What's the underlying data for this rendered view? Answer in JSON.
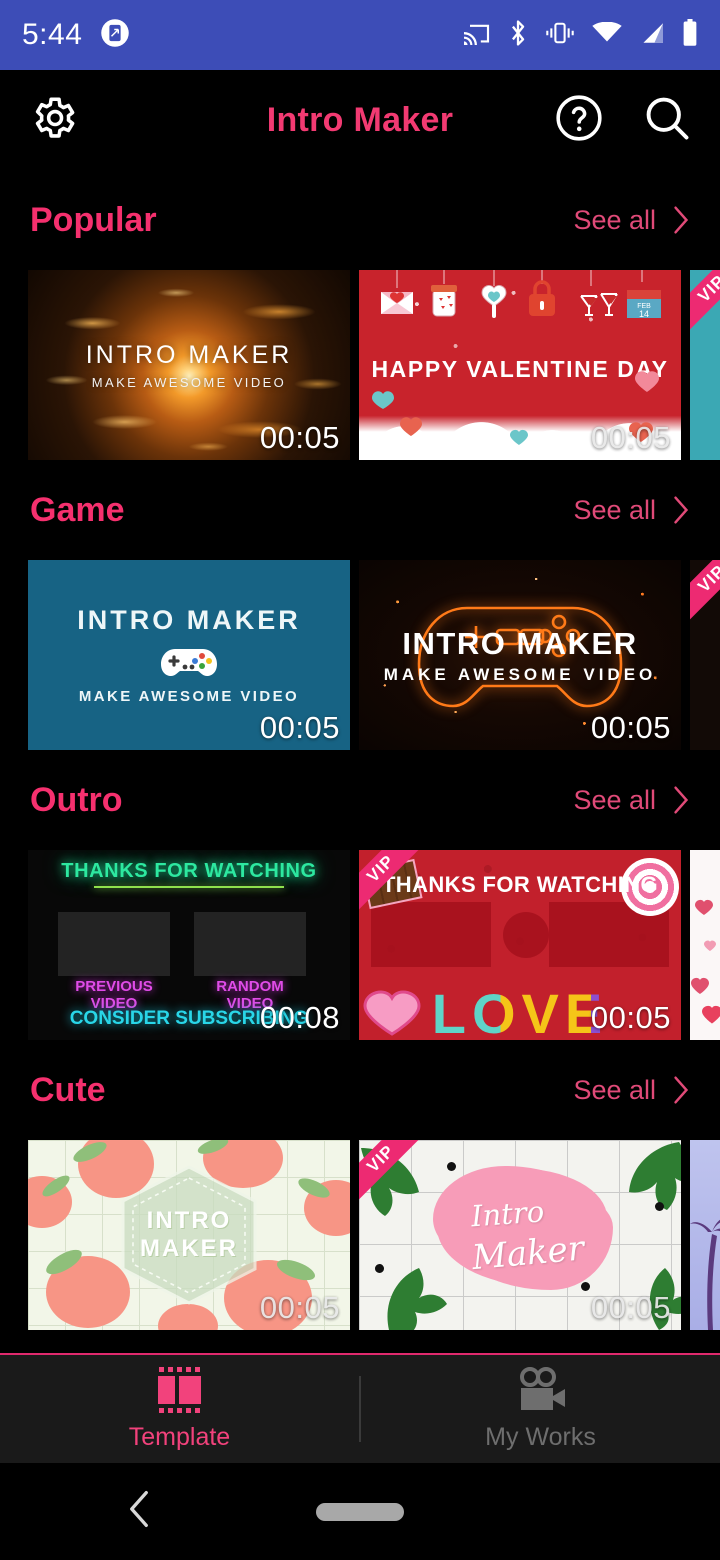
{
  "status_bar": {
    "time": "5:44",
    "bg_color": "#3D4DB7",
    "icons": [
      "screenshot-icon",
      "cast-icon",
      "bluetooth-icon",
      "vibrate-icon",
      "wifi-icon",
      "cellular-signal-icon",
      "battery-icon"
    ]
  },
  "app_bar": {
    "title": "Intro Maker",
    "title_color": "#F23A72",
    "settings_icon": "gear-icon",
    "help_icon": "question-circle-icon",
    "search_icon": "search-icon"
  },
  "see_all_label": "See all",
  "sections": [
    {
      "title": "Popular",
      "cards": [
        {
          "style": "fire",
          "line1": "INTRO MAKER",
          "line2": "MAKE AWESOME VIDEO",
          "duration": "00:05",
          "vip": false
        },
        {
          "style": "valentine",
          "line1": "HAPPY VALENTINE DAY",
          "duration": "00:05",
          "vip": false
        },
        {
          "style": "teal",
          "duration": "",
          "vip": true,
          "vip_label": "VIP"
        }
      ]
    },
    {
      "title": "Game",
      "cards": [
        {
          "style": "game-blue",
          "line1": "INTRO  MAKER",
          "line2": "MAKE  AWESOME  VIDEO",
          "duration": "00:05",
          "vip": false
        },
        {
          "style": "game-neon",
          "line1": "INTRO MAKER",
          "line2": "MAKE AWESOME VIDEO",
          "duration": "00:05",
          "vip": false
        },
        {
          "style": "neon-partial",
          "duration": "",
          "vip": true,
          "vip_label": "VIP"
        }
      ]
    },
    {
      "title": "Outro",
      "cards": [
        {
          "style": "neon-outro",
          "line1": "THANKS FOR WATCHING",
          "line2": "PREVIOUS VIDEO",
          "line3": "RANDOM VIDEO",
          "line4": "CONSIDER SUBSCRIBING",
          "duration": "00:08",
          "vip": false
        },
        {
          "style": "candy-love",
          "line1": "THANKS FOR WATCHING",
          "line2": "LOVE",
          "duration": "00:05",
          "vip": true,
          "vip_label": "VIP"
        },
        {
          "style": "white-hearts",
          "duration": "",
          "vip": false
        }
      ]
    },
    {
      "title": "Cute",
      "cards": [
        {
          "style": "peach-grid",
          "line1": "INTRO",
          "line2": "MAKER",
          "duration": "00:05",
          "vip": false
        },
        {
          "style": "tropical",
          "line1": "Intro",
          "line2": "Maker",
          "duration": "00:05",
          "vip": true,
          "vip_label": "VIP"
        },
        {
          "style": "palm",
          "duration": "",
          "vip": false
        }
      ]
    }
  ],
  "bottom_nav": {
    "tabs": [
      {
        "label": "Template",
        "icon": "film-strip-icon",
        "active": true
      },
      {
        "label": "My Works",
        "icon": "video-camera-icon",
        "active": false
      }
    ],
    "active_color": "#F2427C",
    "inactive_color": "#6E6E6E",
    "border_color": "#E02A6E"
  },
  "gesture_bar": {
    "back_icon": "chevron-left-icon",
    "home_icon": "home-pill-icon"
  }
}
